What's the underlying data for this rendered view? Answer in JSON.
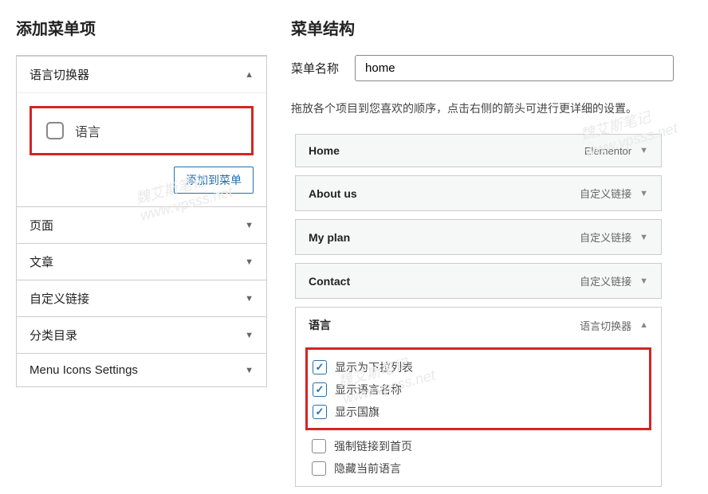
{
  "left": {
    "title": "添加菜单项",
    "sections": [
      {
        "label": "语言切换器",
        "open": true
      },
      {
        "label": "页面",
        "open": false
      },
      {
        "label": "文章",
        "open": false
      },
      {
        "label": "自定义链接",
        "open": false
      },
      {
        "label": "分类目录",
        "open": false
      },
      {
        "label": "Menu Icons Settings",
        "open": false
      }
    ],
    "lang_checkbox_label": "语言",
    "add_button": "添加到菜单"
  },
  "right": {
    "title": "菜单结构",
    "name_label": "菜单名称",
    "name_value": "home",
    "hint": "拖放各个项目到您喜欢的顺序，点击右侧的箭头可进行更详细的设置。",
    "items": [
      {
        "title": "Home",
        "type": "Elementor",
        "open": false
      },
      {
        "title": "About us",
        "type": "自定义链接",
        "open": false
      },
      {
        "title": "My plan",
        "type": "自定义链接",
        "open": false
      },
      {
        "title": "Contact",
        "type": "自定义链接",
        "open": false
      },
      {
        "title": "语言",
        "type": "语言切换器",
        "open": true
      }
    ],
    "options": [
      {
        "label": "显示为下拉列表",
        "checked": true
      },
      {
        "label": "显示语言名称",
        "checked": true
      },
      {
        "label": "显示国旗",
        "checked": true
      },
      {
        "label": "强制链接到首页",
        "checked": false
      },
      {
        "label": "隐藏当前语言",
        "checked": false
      }
    ]
  }
}
